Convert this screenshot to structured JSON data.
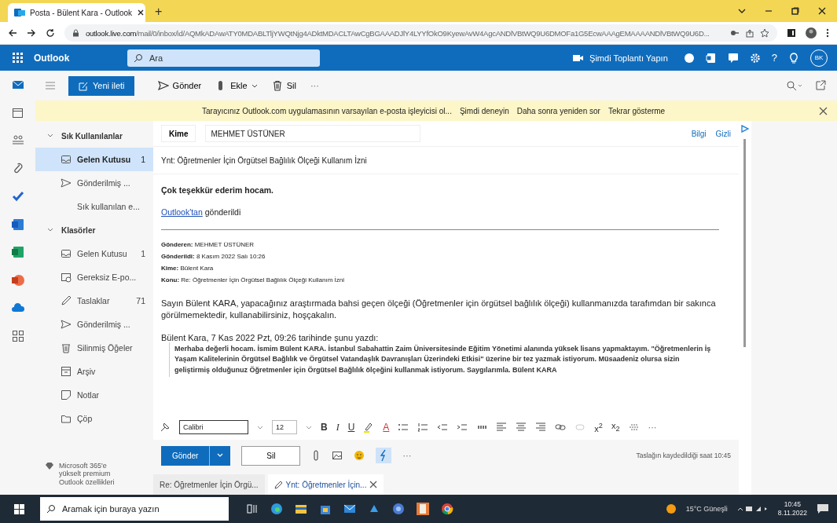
{
  "browser": {
    "tabs": [
      {
        "title": "Posta - Bülent Kara - Outlook",
        "selected": true
      }
    ],
    "new_tab": "+",
    "url_host": "outlook.live.com",
    "url_path": "/mail/0/inbox/id/AQMkADAwATY0MDABLTljYWQtNjg4ADktMDACLTAwCgBGAAADJlY4LYYfOkO9KyewAvW4AgcANDlVBtWQ9U6DMOFa1G5EcwAAAgEMAAAANDlVBtWQ9U6D..."
  },
  "header": {
    "app_name": "Outlook",
    "search_placeholder": "Ara",
    "meet_now": "Şimdi Toplantı Yapın",
    "help": "?",
    "avatar": "BK"
  },
  "toolbar": {
    "new_message": "Yeni ileti",
    "actions": [
      {
        "label": "Gönder",
        "kind": "send",
        "dropdown": false
      },
      {
        "label": "Ekle",
        "kind": "attach",
        "dropdown": true
      },
      {
        "label": "Sil",
        "kind": "delete",
        "dropdown": false
      }
    ],
    "more": "···"
  },
  "banner": {
    "text": "Tarayıcınız Outlook.com uygulamasının varsayılan e-posta işleyicisi ol...",
    "links": [
      "Şimdi deneyin",
      "Daha sonra yeniden sor",
      "Tekrar gösterme"
    ]
  },
  "folders": {
    "groups": [
      {
        "label": "Sık Kullanılanlar",
        "expanded": true,
        "items": [
          {
            "label": "Gelen Kutusu",
            "kind": "inbox",
            "count": "1",
            "selected": true
          },
          {
            "label": "Gönderilmiş ...",
            "kind": "sent",
            "selected": false
          },
          {
            "label": "Sık kullanılan e...",
            "kind": "none",
            "selected": false
          }
        ]
      },
      {
        "label": "Klasörler",
        "expanded": true,
        "items": [
          {
            "label": "Gelen Kutusu",
            "kind": "inbox",
            "count": "1",
            "selected": false
          },
          {
            "label": "Gereksiz E-po...",
            "kind": "junk",
            "selected": false
          },
          {
            "label": "Taslaklar",
            "kind": "drafts",
            "count": "71",
            "selected": false
          },
          {
            "label": "Gönderilmiş ...",
            "kind": "sent",
            "selected": false
          },
          {
            "label": "Silinmiş Öğeler",
            "kind": "delete",
            "selected": false
          },
          {
            "label": "Arşiv",
            "kind": "archive",
            "selected": false
          },
          {
            "label": "Notlar",
            "kind": "notes",
            "selected": false
          },
          {
            "label": "Çöp",
            "kind": "folder",
            "selected": false
          }
        ]
      }
    ],
    "promo": "Microsoft 365'e yükselt premium Outlook özellikleri"
  },
  "compose": {
    "to_label": "Kime",
    "recipients": [
      "MEHMET ÜSTÜNER"
    ],
    "cc": "Bilgi",
    "bcc": "Gizli",
    "subject": "Ynt: Öğretmenler İçin Örgütsel Bağlılık Ölçeği Kullanım İzni",
    "reply": "Çok teşekkür ederim hocam.",
    "signature_link": "Outlook'tan",
    "signature_rest": "gönderildi",
    "quoted_header": [
      {
        "label": "Gönderen:",
        "value": "MEHMET ÜSTÜNER"
      },
      {
        "label": "Gönderildi:",
        "value": "8 Kasım 2022 Salı 10:26"
      },
      {
        "label": "Kime:",
        "value": "Bülent Kara"
      },
      {
        "label": "Konu:",
        "value": "Re: Öğretmenler İçin Örgütsel Bağlılık Ölçeği Kullanım İzni"
      }
    ],
    "message": "Sayın Bülent KARA, yapacağınız araştırmada bahsi geçen ölçeği (Öğretmenler için örgütsel bağlılık ölçeği) kullanmanızda tarafımdan bir sakınca görülmemektedir, kullanabilirsiniz, hoşçakalın.",
    "quote_intro": "Bülent Kara, 7 Kas 2022 Pzt, 09:26 tarihinde şunu yazdı:",
    "quote": "Merhaba değerli hocam. İsmim Bülent KARA. İstanbul Sabahattin Zaim Üniversitesinde Eğitim Yönetimi alanında yüksek lisans yapmaktayım. \"Öğretmenlerin İş Yaşam Kalitelerinin Örgütsel Bağlılık ve Örgütsel Vatandaşlık Davranışları Üzerindeki Etkisi\" üzerine bir tez yazmak istiyorum. Müsaadeniz olursa sizin geliştirmiş olduğunuz Öğretmenler için Örgütsel Bağlılık ölçeğini kullanmak istiyorum. Saygılarımla. Bülent KARA"
  },
  "format_toolbar": {
    "font": "Calibri",
    "size": "12",
    "text_buttons": [
      {
        "label": "B",
        "kind": "bold"
      },
      {
        "label": "I",
        "kind": "italic"
      },
      {
        "label": "U",
        "kind": "underline"
      }
    ],
    "font_color": "A",
    "scripts": [
      "x$^{2}$",
      "x$_{2}$"
    ],
    "more": "···"
  },
  "send_row": {
    "send": "Gönder",
    "discard": "Sil",
    "more": "···",
    "status": "Taslağın kaydedildiği saat 10:45"
  },
  "bottom_tabs": [
    {
      "label": "Re: Öğretmenler İçin Örgü...",
      "selected": false,
      "closable": false
    },
    {
      "label": "Ynt: Öğretmenler İçin...",
      "selected": true,
      "closable": true
    }
  ],
  "taskbar": {
    "search_placeholder": "Aramak için buraya yazın",
    "weather": "15°C Güneşli",
    "time": "10:45",
    "date": "8.11.2022"
  }
}
